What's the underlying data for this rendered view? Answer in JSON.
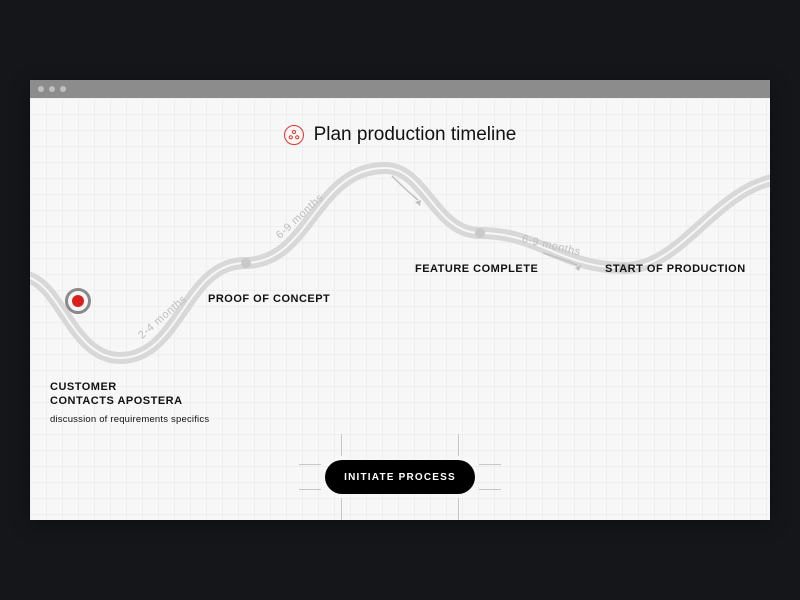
{
  "header": {
    "title": "Plan production timeline",
    "icon": "team-icon"
  },
  "milestones": [
    {
      "id": "m0",
      "label_line1": "CUSTOMER",
      "label_line2": "CONTACTS APOSTERA",
      "sub": "discussion of requirements specifics"
    },
    {
      "id": "m1",
      "label_line1": "PROOF OF CONCEPT"
    },
    {
      "id": "m2",
      "label_line1": "FEATURE COMPLETE"
    },
    {
      "id": "m3",
      "label_line1": "START OF PRODUCTION"
    }
  ],
  "edges": [
    {
      "from": "m0",
      "to": "m1",
      "duration": "2-4 months"
    },
    {
      "from": "m1",
      "to": "m2",
      "duration": "6-9 months"
    },
    {
      "from": "m2",
      "to": "m3",
      "duration": "6-9 months"
    }
  ],
  "cta": {
    "label": "INITIATE PROCESS"
  }
}
